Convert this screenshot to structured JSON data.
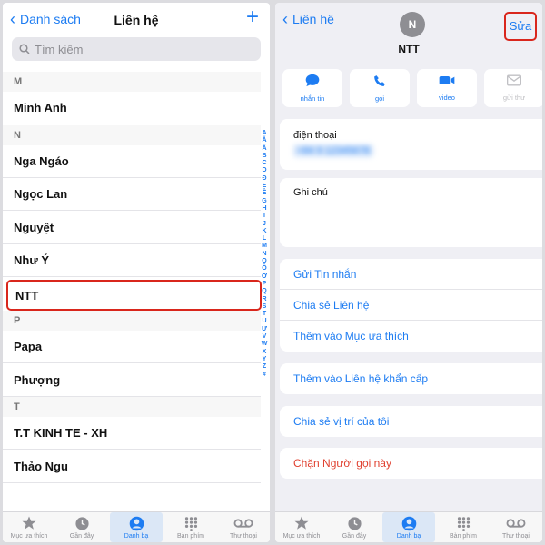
{
  "left": {
    "back_label": "Danh sách",
    "title": "Liên hệ",
    "add_symbol": "+",
    "search_placeholder": "Tìm kiếm",
    "rows": [
      {
        "type": "section",
        "label": "M"
      },
      {
        "type": "contact",
        "label": "Minh Anh"
      },
      {
        "type": "section",
        "label": "N"
      },
      {
        "type": "contact",
        "label": "Nga Ngáo"
      },
      {
        "type": "contact",
        "label": "Ngọc Lan"
      },
      {
        "type": "contact",
        "label": "Nguyệt"
      },
      {
        "type": "contact",
        "label": "Như Ý"
      },
      {
        "type": "contact",
        "label": "NTT",
        "highlighted": true
      },
      {
        "type": "section",
        "label": "P"
      },
      {
        "type": "contact",
        "label": "Papa"
      },
      {
        "type": "contact",
        "label": "Phượng"
      },
      {
        "type": "section",
        "label": "T"
      },
      {
        "type": "contact",
        "label": "T.T KINH TE - XH"
      },
      {
        "type": "contact",
        "label": "Thảo Ngu"
      }
    ],
    "index_letters": [
      "A",
      "Ă",
      "Â",
      "B",
      "C",
      "D",
      "Đ",
      "E",
      "Ê",
      "G",
      "H",
      "I",
      "J",
      "K",
      "L",
      "M",
      "N",
      "O",
      "Ô",
      "Ơ",
      "P",
      "Q",
      "R",
      "S",
      "T",
      "U",
      "Ư",
      "V",
      "W",
      "X",
      "Y",
      "Z",
      "#"
    ]
  },
  "right": {
    "back_label": "Liên hệ",
    "avatar_initial": "N",
    "contact_name": "NTT",
    "edit_label": "Sửa",
    "actions": [
      {
        "label": "nhắn tin",
        "icon": "message-icon",
        "enabled": true
      },
      {
        "label": "gọi",
        "icon": "phone-icon",
        "enabled": true
      },
      {
        "label": "video",
        "icon": "video-icon",
        "enabled": true
      },
      {
        "label": "gửi thư",
        "icon": "mail-icon",
        "enabled": false
      }
    ],
    "phone_label": "điện thoại",
    "phone_value": "+84 9 12345678",
    "notes_label": "Ghi chú",
    "menu_group1": [
      "Gửi Tin nhắn",
      "Chia sẻ Liên hệ",
      "Thêm vào Mục ưa thích"
    ],
    "emergency": "Thêm vào Liên hệ khẩn cấp",
    "share_location": "Chia sẻ vị trí của tôi",
    "block": "Chặn Người gọi này"
  },
  "tabs": [
    {
      "label": "Mục ưa thích",
      "icon": "star-icon",
      "active": false
    },
    {
      "label": "Gần đây",
      "icon": "clock-icon",
      "active": false
    },
    {
      "label": "Danh bạ",
      "icon": "person-icon",
      "active": true
    },
    {
      "label": "Bàn phím",
      "icon": "keypad-icon",
      "active": false
    },
    {
      "label": "Thư thoại",
      "icon": "voicemail-icon",
      "active": false
    }
  ],
  "colors": {
    "accent": "#1d7cf2",
    "highlight": "#d9261c",
    "danger": "#e0402f"
  }
}
